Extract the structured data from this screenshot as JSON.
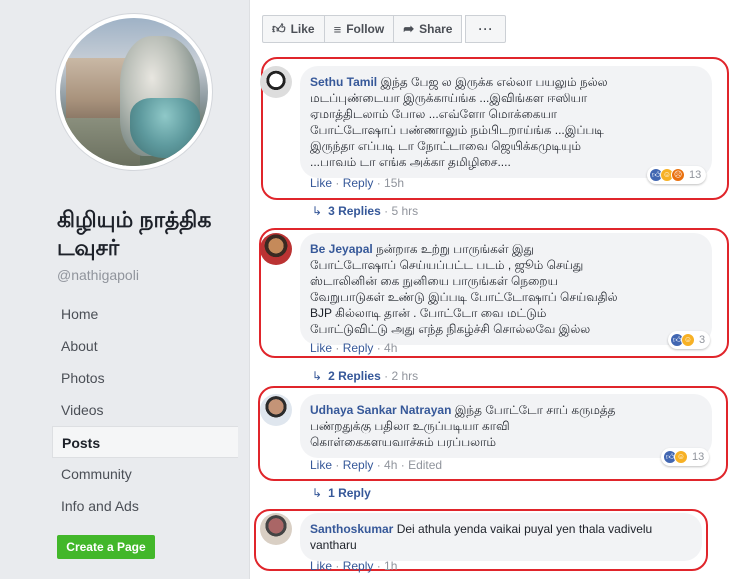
{
  "page": {
    "name": "கிழியும் நாத்திக டவுசர்",
    "handle": "@nathigapoli",
    "nav": [
      "Home",
      "About",
      "Photos",
      "Videos",
      "Posts",
      "Community",
      "Info and Ads"
    ],
    "create_button": "Create a Page"
  },
  "actions": {
    "like": "Like",
    "follow": "Follow",
    "share": "Share",
    "more": "···"
  },
  "comments": [
    {
      "author": "Sethu Tamil",
      "lines": [
        "இந்த பேஜ ல இருக்க எல்லா பயலும் நல்ல",
        "மடப்புண்டையா இருக்காய்ங்க ...இவிங்கள ஈஸியா",
        "ஏமாத்திடலாம் போல ...எவ்ளோ மொக்கையா",
        "போட்டோஷாப் பண்ணாலும் நம்பிடறாய்ங்க ...இப்படி",
        "இருந்தா எப்படி டா நோட்டாவை ஜெயிக்கமுடியும்",
        "...பாவம் டா எங்க அக்கா தமிழிசை...."
      ],
      "like": "Like",
      "reply": "Reply",
      "time": "15h",
      "reaction_count": "13",
      "replies_label": "3 Replies",
      "replies_time": "5 hrs"
    },
    {
      "author": "Be Jeyapal",
      "lines": [
        "நன்றாக உற்று பாருங்கள் இது",
        "போட்டோஷாப் செய்யப்பட்ட படம் , ஜூம் செய்து",
        "ஸ்டாலினின் கை நுனியை பாருங்கள் நெறைய",
        "வேறுபாடுகள் உண்டு இப்படி போட்டோஷாப் செய்வதில்",
        "BJP கில்லாடி தான் . போட்டோ வை மட்டும்",
        "போட்டுவிட்டு அது எந்த நிகழ்ச்சி சொல்லவே இல்ல"
      ],
      "like": "Like",
      "reply": "Reply",
      "time": "4h",
      "reaction_count": "3",
      "replies_label": "2 Replies",
      "replies_time": "2 hrs"
    },
    {
      "author": "Udhaya Sankar Natrayan",
      "lines": [
        "இந்த போட்டோ சாப் கருமத்த",
        "பண்றதுக்கு பதிலா உருப்படியா காவி",
        "கொள்கைகளயவாச்சும் பரப்பலாம்"
      ],
      "like": "Like",
      "reply": "Reply",
      "time": "4h",
      "edited": "Edited",
      "reaction_count": "13",
      "replies_label": "1 Reply"
    },
    {
      "author": "Santhoskumar",
      "lines": [
        "Dei athula yenda vaikai puyal yen thala vadivelu",
        "vantharu"
      ],
      "like": "Like",
      "reply": "Reply",
      "time": "1h"
    }
  ],
  "colors": {
    "highlight_ring": "#e0252b",
    "link": "#365899",
    "create_button": "#42b72a"
  }
}
